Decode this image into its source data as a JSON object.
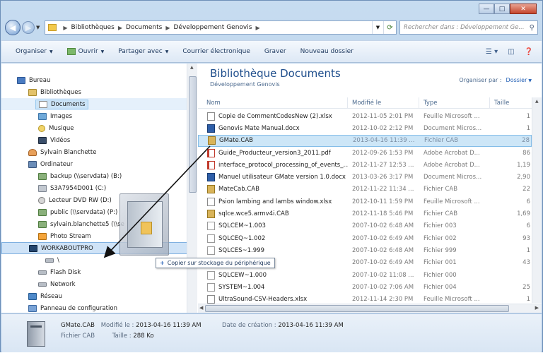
{
  "address": {
    "crumbs": [
      "Bibliothèques",
      "Documents",
      "Développement Genovis"
    ],
    "search_placeholder": "Rechercher dans : Développement Ge..."
  },
  "toolbar": {
    "organize": "Organiser",
    "open": "Ouvrir",
    "share": "Partager avec",
    "email": "Courrier électronique",
    "burn": "Graver",
    "new_folder": "Nouveau dossier"
  },
  "nav": {
    "items": [
      {
        "label": "Bureau",
        "icon": "desktop-icon"
      },
      {
        "label": "Bibliothèques",
        "icon": "libraries-icon"
      },
      {
        "label": "Documents",
        "icon": "documents-icon"
      },
      {
        "label": "Images",
        "icon": "images-icon"
      },
      {
        "label": "Musique",
        "icon": "music-icon"
      },
      {
        "label": "Vidéos",
        "icon": "videos-icon"
      },
      {
        "label": "Sylvain Blanchette",
        "icon": "user-icon"
      },
      {
        "label": "Ordinateur",
        "icon": "computer-icon"
      },
      {
        "label": "backup (\\\\servdata) (B:)",
        "icon": "network-drive-icon"
      },
      {
        "label": "S3A7954D001 (C:)",
        "icon": "disk-icon"
      },
      {
        "label": "Lecteur DVD RW (D:)",
        "icon": "dvd-icon"
      },
      {
        "label": "public (\\\\servdata) (P:)",
        "icon": "network-drive-icon"
      },
      {
        "label": "sylvain.blanchette5 (\\\\se",
        "icon": "network-drive-icon"
      },
      {
        "label": "Photo Stream",
        "icon": "photo-stream-icon"
      },
      {
        "label": "WORKABOUTPRO",
        "icon": "device-icon"
      },
      {
        "label": "\\",
        "icon": "drive-icon"
      },
      {
        "label": "Flash Disk",
        "icon": "flash-disk-icon"
      },
      {
        "label": "Network",
        "icon": "network-folder-icon"
      },
      {
        "label": "Réseau",
        "icon": "network-icon"
      },
      {
        "label": "Panneau de configuration",
        "icon": "control-panel-icon"
      }
    ]
  },
  "library": {
    "title": "Bibliothèque Documents",
    "subtitle": "Développement Genovis",
    "arrange_label": "Organiser par :",
    "arrange_value": "Dossier"
  },
  "columns": {
    "name": "Nom",
    "modified": "Modifié le",
    "type": "Type",
    "size": "Taille"
  },
  "files": [
    {
      "name": "Copie de CommentCodesNew (2).xlsx",
      "modified": "2012-11-05 2:01 PM",
      "type": "Feuille Microsoft ...",
      "size": "1",
      "icon": "xlsx"
    },
    {
      "name": "Genovis Mate Manual.docx",
      "modified": "2012-10-02 2:12 PM",
      "type": "Document Micros...",
      "size": "1",
      "icon": "docx"
    },
    {
      "name": "GMate.CAB",
      "modified": "2013-04-16 11:39 ...",
      "type": "Fichier CAB",
      "size": "28",
      "icon": "cab",
      "selected": true
    },
    {
      "name": "Guide_Producteur_version3_2011.pdf",
      "modified": "2012-09-26 1:53 PM",
      "type": "Adobe Acrobat D...",
      "size": "86",
      "icon": "pdf"
    },
    {
      "name": "interface_protocol_processing_of_events_...",
      "modified": "2012-11-27 12:53 ...",
      "type": "Adobe Acrobat D...",
      "size": "1,19",
      "icon": "pdf"
    },
    {
      "name": "Manuel utilisateur GMate version 1.0.docx",
      "modified": "2013-03-26 3:17 PM",
      "type": "Document Micros...",
      "size": "2,90",
      "icon": "docx"
    },
    {
      "name": "MateCab.CAB",
      "modified": "2012-11-22 11:34 ...",
      "type": "Fichier CAB",
      "size": "22",
      "icon": "cab"
    },
    {
      "name": "Psion lambing and lambs window.xlsx",
      "modified": "2012-10-11 1:59 PM",
      "type": "Feuille Microsoft ...",
      "size": "6",
      "icon": "xlsx"
    },
    {
      "name": "sqlce.wce5.armv4i.CAB",
      "modified": "2012-11-18 5:46 PM",
      "type": "Fichier CAB",
      "size": "1,69",
      "icon": "cab"
    },
    {
      "name": "SQLCEM~1.003",
      "modified": "2007-10-02 6:48 AM",
      "type": "Fichier 003",
      "size": "6",
      "icon": "blank"
    },
    {
      "name": "SQLCEQ~1.002",
      "modified": "2007-10-02 6:49 AM",
      "type": "Fichier 002",
      "size": "93",
      "icon": "blank"
    },
    {
      "name": "SQLCES~1.999",
      "modified": "2007-10-02 6:48 AM",
      "type": "Fichier 999",
      "size": "1",
      "icon": "blank"
    },
    {
      "name": "",
      "modified": "2007-10-02 6:49 AM",
      "type": "Fichier 001",
      "size": "43",
      "icon": "blank"
    },
    {
      "name": "SQLCEW~1.000",
      "modified": "2007-10-02 11:08 ...",
      "type": "Fichier 000",
      "size": "",
      "icon": "blank"
    },
    {
      "name": "SYSTEM~1.004",
      "modified": "2007-10-02 7:06 AM",
      "type": "Fichier 004",
      "size": "25",
      "icon": "blank"
    },
    {
      "name": "UltraSound-CSV-Headers.xlsx",
      "modified": "2012-11-14 2:30 PM",
      "type": "Feuille Microsoft ...",
      "size": "1",
      "icon": "xlsx"
    }
  ],
  "drag_tooltip": "Copier sur stockage du périphérique",
  "details": {
    "name": "GMate.CAB",
    "modified_label": "Modifié le :",
    "modified": "2013-04-16 11:39 AM",
    "created_label": "Date de création :",
    "created": "2013-04-16 11:39 AM",
    "type": "Fichier CAB",
    "size_label": "Taille :",
    "size": "288 Ko"
  }
}
